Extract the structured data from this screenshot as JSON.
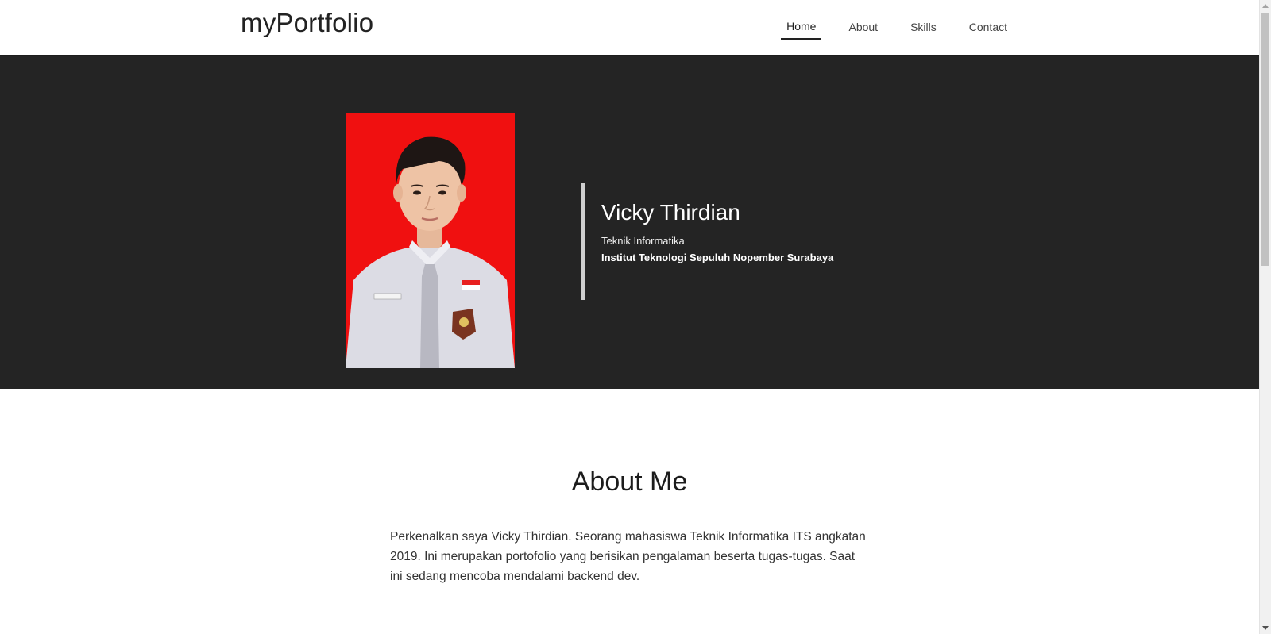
{
  "header": {
    "brand": "myPortfolio",
    "nav": [
      {
        "label": "Home",
        "active": true
      },
      {
        "label": "About",
        "active": false
      },
      {
        "label": "Skills",
        "active": false
      },
      {
        "label": "Contact",
        "active": false
      }
    ]
  },
  "hero": {
    "photo": {
      "background_color": "#f01010",
      "shirt_color": "#dcdce4",
      "tie_color": "#b8b8c2"
    },
    "name": "Vicky Thirdian",
    "line1": "Teknik Informatika",
    "line2": "Institut Teknologi Sepuluh Nopember Surabaya",
    "background_color": "#242424"
  },
  "about": {
    "title": "About Me",
    "paragraph": "Perkenalkan saya Vicky Thirdian. Seorang mahasiswa Teknik Informatika ITS angkatan 2019. Ini merupakan portofolio yang berisikan pengalaman beserta tugas-tugas. Saat ini sedang mencoba mendalami backend dev."
  }
}
